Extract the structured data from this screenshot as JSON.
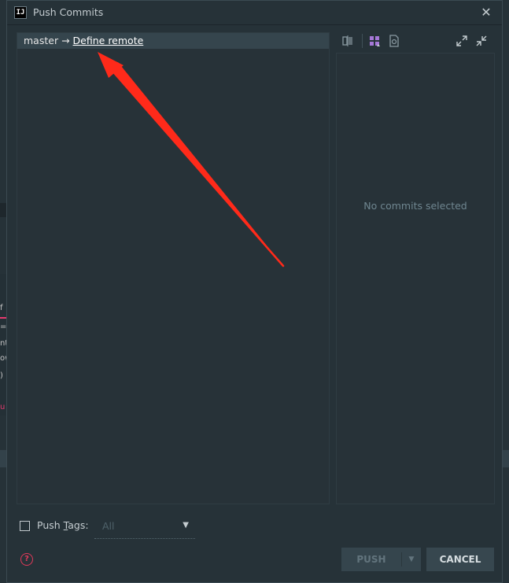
{
  "background": {
    "text_fragments": [
      "f",
      "=",
      "nt",
      "ow",
      ")",
      "u"
    ]
  },
  "dialog": {
    "title": "Push Commits",
    "app_icon_label": "IJ",
    "close_label": "✕"
  },
  "commits_panel": {
    "local_branch": "master",
    "arrow": "→",
    "remote_link": "Define remote"
  },
  "details_panel": {
    "empty_message": "No commits selected"
  },
  "toolbar": {
    "icons": [
      "split-view-icon",
      "group-by-icon",
      "open-diff-icon",
      "expand-all-icon",
      "collapse-all-icon"
    ]
  },
  "options": {
    "push_tags_prefix": "Push ",
    "push_tags_mnemonic": "T",
    "push_tags_suffix": "ags:",
    "tags_selected": "All"
  },
  "buttons": {
    "push": "PUSH",
    "cancel": "CANCEL",
    "help": "?"
  },
  "colors": {
    "background": "#263238",
    "accent_help": "#e0395a",
    "annotation_arrow": "#ff2a1a",
    "group_icon": "#a678d8"
  }
}
